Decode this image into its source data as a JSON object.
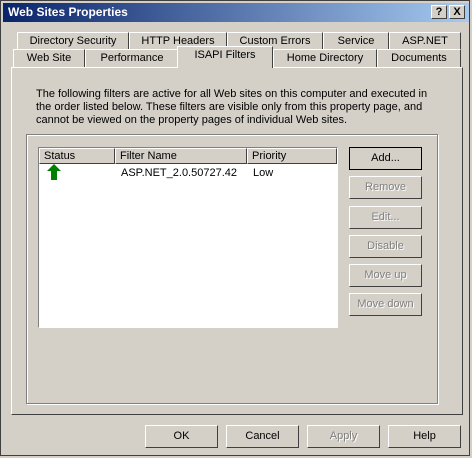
{
  "window": {
    "title": "Web Sites Properties"
  },
  "titlebar_buttons": {
    "help": "?",
    "close": "X"
  },
  "tabs_row1": [
    "Directory Security",
    "HTTP Headers",
    "Custom Errors",
    "Service",
    "ASP.NET"
  ],
  "tabs_row2": [
    "Web Site",
    "Performance",
    "ISAPI Filters",
    "Home Directory",
    "Documents"
  ],
  "active_tab": "ISAPI Filters",
  "description": "The following filters are active for all Web sites on this computer and executed in the order listed below. These filters are visible only from this property page, and cannot be viewed on the property pages of individual Web sites.",
  "list": {
    "columns": [
      "Status",
      "Filter Name",
      "Priority"
    ],
    "rows": [
      {
        "status_icon": "green-up-arrow-icon",
        "filter_name": "ASP.NET_2.0.50727.42",
        "priority": "Low"
      }
    ]
  },
  "side_buttons": {
    "add": "Add...",
    "remove": "Remove",
    "edit": "Edit...",
    "disable": "Disable",
    "move_up": "Move up",
    "move_down": "Move down"
  },
  "bottom_buttons": {
    "ok": "OK",
    "cancel": "Cancel",
    "apply": "Apply",
    "help": "Help"
  },
  "colors": {
    "titlebar_start": "#0a246a",
    "titlebar_end": "#a6caf0",
    "status_arrow": "#008000"
  }
}
